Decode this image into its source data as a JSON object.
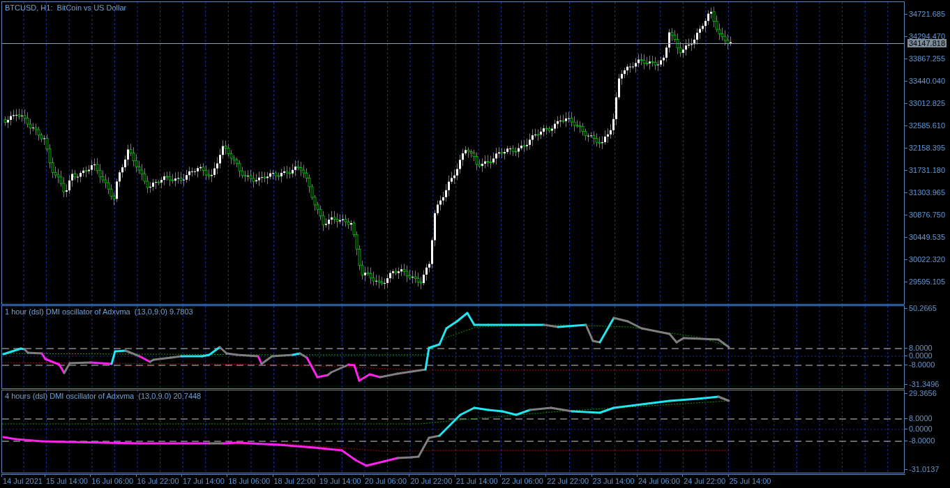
{
  "chart": {
    "title": "BTCUSD, H1:  BitCoin vs US Dollar",
    "price_axis": [
      "34721.685",
      "34294.470",
      "33867.255",
      "33440.040",
      "33012.825",
      "32585.610",
      "32158.395",
      "31731.180",
      "31303.965",
      "30876.750",
      "30449.535",
      "30022.320",
      "29595.105"
    ],
    "current_price": "34147.818"
  },
  "indicators": [
    {
      "title": "1 hour (dsl) DMI oscillator of Adxvma  (13,0,9.0) 9.7803",
      "axis": [
        "50.2665",
        "8.0000",
        "0.0000",
        "-8.0000",
        "-31.3496"
      ]
    },
    {
      "title": "4 hours (dsl) DMI oscillator of Adxvma  (13,0,9.0) 20.7448",
      "axis": [
        "29.3656",
        "8.0000",
        "0.0000",
        "-8.0000",
        "-31.0137"
      ]
    }
  ],
  "time_axis": [
    "14 Jul 2021",
    "15 Jul 14:00",
    "16 Jul 06:00",
    "16 Jul 22:00",
    "17 Jul 14:00",
    "18 Jul 06:00",
    "18 Jul 22:00",
    "19 Jul 14:00",
    "20 Jul 06:00",
    "20 Jul 22:00",
    "21 Jul 14:00",
    "22 Jul 06:00",
    "22 Jul 22:00",
    "23 Jul 14:00",
    "24 Jul 06:00",
    "24 Jul 22:00",
    "25 Jul 14:00"
  ]
}
